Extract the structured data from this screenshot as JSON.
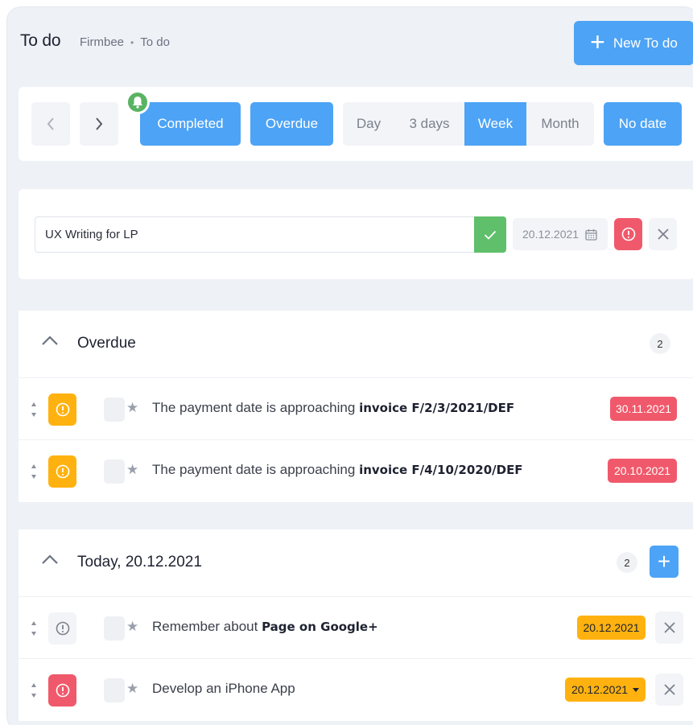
{
  "header": {
    "title": "To do",
    "breadcrumb": [
      "Firmbee",
      "•",
      "To do"
    ],
    "new_button": "New To do"
  },
  "toolbar": {
    "prev_icon": "chevron-left-icon",
    "next_icon": "chevron-right-icon",
    "completed": "Completed",
    "overdue": "Overdue",
    "ranges": [
      "Day",
      "3 days",
      "Week",
      "Month"
    ],
    "active_range": "Week",
    "no_date": "No date"
  },
  "new_task": {
    "value": "UX Writing for LP",
    "date": "20.12.2021"
  },
  "sections": [
    {
      "title": "Overdue",
      "count": "2",
      "rows": [
        {
          "priority": "yellow",
          "text": "The payment date is approaching ",
          "bold": "invoice F/2/3/2021/DEF",
          "date": "30.11.2021",
          "date_color": "red"
        },
        {
          "priority": "yellow",
          "text": "The payment date is approaching ",
          "bold": "invoice F/4/10/2020/DEF",
          "date": "20.10.2021",
          "date_color": "red"
        }
      ]
    },
    {
      "title": "Today, 20.12.2021",
      "count": "2",
      "add_label": "+",
      "rows": [
        {
          "priority": "grey",
          "text": "Remember about ",
          "bold": "Page on Google+",
          "date": "20.12.2021",
          "date_color": "yellow"
        },
        {
          "priority": "red",
          "text": "Develop an iPhone App",
          "bold": "",
          "date": "20.12.2021",
          "date_color": "yellow"
        }
      ]
    }
  ],
  "colors": {
    "accent": "#4da3f5",
    "success": "#5fbf6a",
    "danger": "#f0596b",
    "warning": "#ffb20f",
    "bell": "#59b363"
  }
}
